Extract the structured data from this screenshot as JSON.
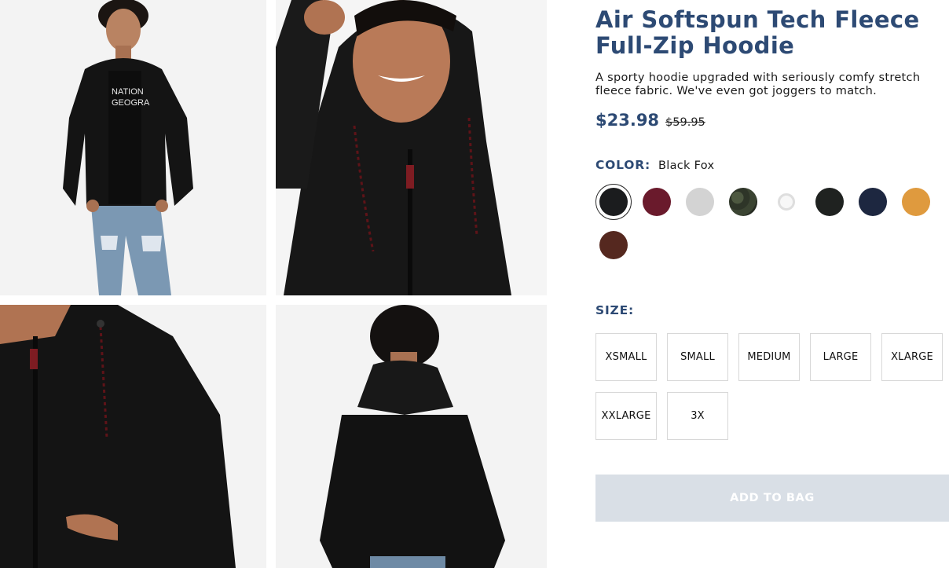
{
  "product": {
    "title": "Air Softspun Tech Fleece Full-Zip Hoodie",
    "description": "A sporty hoodie upgraded with seriously comfy stretch fleece fabric. We've even got joggers to match.",
    "price": "$23.98",
    "compare_price": "$59.95"
  },
  "color": {
    "label": "COLOR:",
    "selected": "Black Fox",
    "swatches": [
      {
        "name": "black-fox",
        "hex": "#1b1c1e",
        "selected": true
      },
      {
        "name": "burgundy",
        "hex": "#6a1a2c"
      },
      {
        "name": "light-heather-grey",
        "hex": "#d3d3d3"
      },
      {
        "name": "camo",
        "hex": "#3a4231"
      },
      {
        "name": "white",
        "hex": "#f4f4f4"
      },
      {
        "name": "black",
        "hex": "#1f2220"
      },
      {
        "name": "navy",
        "hex": "#1d2740"
      },
      {
        "name": "mustard",
        "hex": "#df9a3e"
      },
      {
        "name": "brown",
        "hex": "#55281f"
      }
    ]
  },
  "size": {
    "label": "SIZE:",
    "options": [
      "XSMALL",
      "SMALL",
      "MEDIUM",
      "LARGE",
      "XLARGE",
      "XXLARGE",
      "3X"
    ]
  },
  "add_to_bag": "ADD TO BAG",
  "photos": [
    {
      "name": "model-front-full-photo"
    },
    {
      "name": "model-hood-up-photo"
    },
    {
      "name": "hoodie-front-closeup-photo"
    },
    {
      "name": "model-back-view-photo"
    }
  ],
  "colors": {
    "accent": "#2d4a74",
    "button_disabled": "#d9dfe6"
  }
}
